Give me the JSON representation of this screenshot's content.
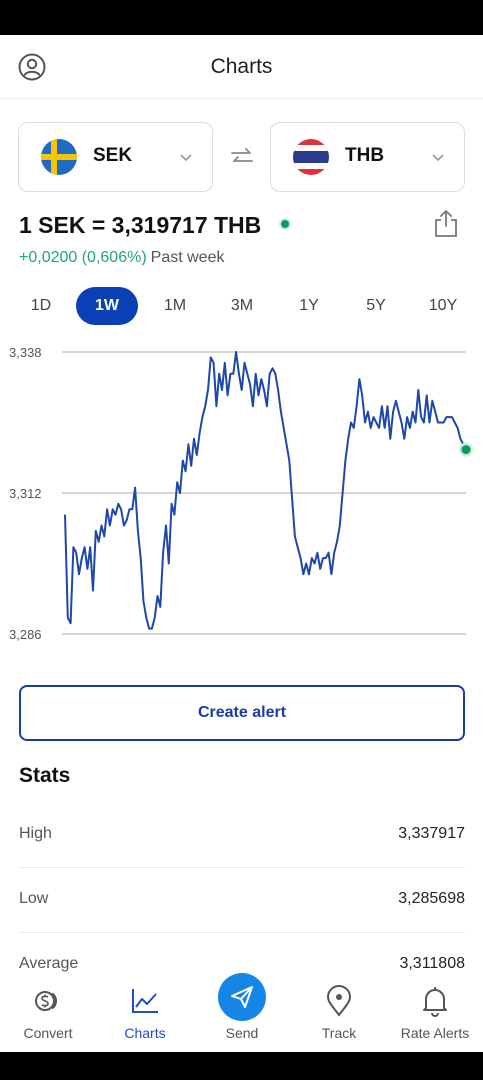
{
  "header": {
    "title": "Charts",
    "profile_icon": "profile-icon"
  },
  "pair": {
    "from": {
      "code": "SEK",
      "flag": "sweden-flag"
    },
    "to": {
      "code": "THB",
      "flag": "thailand-flag"
    }
  },
  "rate": {
    "text": "1 SEK = 3,319717 THB",
    "change": "+0,0200 (0,606%)",
    "period": "Past week"
  },
  "ranges": [
    {
      "label": "1D",
      "active": false
    },
    {
      "label": "1W",
      "active": true
    },
    {
      "label": "1M",
      "active": false
    },
    {
      "label": "3M",
      "active": false
    },
    {
      "label": "1Y",
      "active": false
    },
    {
      "label": "5Y",
      "active": false
    },
    {
      "label": "10Y",
      "active": false
    }
  ],
  "chart_data": {
    "type": "line",
    "ytick_labels": [
      "3,338",
      "3,312",
      "3,286"
    ],
    "yticks": [
      3.338,
      3.312,
      3.286
    ],
    "ylim": [
      3.286,
      3.338
    ],
    "grid": true,
    "series": [
      {
        "color": "#1f47a8",
        "values": [
          3.308,
          3.289,
          3.288,
          3.302,
          3.301,
          3.297,
          3.3,
          3.302,
          3.298,
          3.302,
          3.294,
          3.305,
          3.303,
          3.306,
          3.304,
          3.309,
          3.306,
          3.309,
          3.308,
          3.31,
          3.309,
          3.306,
          3.307,
          3.309,
          3.309,
          3.313,
          3.305,
          3.3,
          3.292,
          3.289,
          3.287,
          3.287,
          3.289,
          3.293,
          3.291,
          3.301,
          3.306,
          3.299,
          3.31,
          3.308,
          3.314,
          3.312,
          3.318,
          3.316,
          3.321,
          3.317,
          3.322,
          3.319,
          3.323,
          3.326,
          3.328,
          3.331,
          3.337,
          3.336,
          3.328,
          3.334,
          3.331,
          3.336,
          3.33,
          3.334,
          3.334,
          3.338,
          3.334,
          3.331,
          3.336,
          3.334,
          3.332,
          3.328,
          3.334,
          3.33,
          3.333,
          3.331,
          3.328,
          3.334,
          3.335,
          3.334,
          3.331,
          3.327,
          3.324,
          3.321,
          3.318,
          3.311,
          3.304,
          3.302,
          3.3,
          3.297,
          3.299,
          3.297,
          3.3,
          3.299,
          3.301,
          3.298,
          3.3,
          3.3,
          3.301,
          3.297,
          3.301,
          3.303,
          3.306,
          3.312,
          3.318,
          3.322,
          3.325,
          3.324,
          3.328,
          3.333,
          3.33,
          3.325,
          3.327,
          3.324,
          3.326,
          3.325,
          3.324,
          3.328,
          3.324,
          3.328,
          3.322,
          3.327,
          3.329,
          3.327,
          3.325,
          3.322,
          3.326,
          3.324,
          3.327,
          3.325,
          3.331,
          3.326,
          3.325,
          3.33,
          3.325,
          3.329,
          3.327,
          3.325,
          3.325,
          3.325,
          3.326,
          3.326,
          3.326,
          3.325,
          3.324,
          3.322,
          3.321,
          3.32
        ]
      }
    ]
  },
  "create_alert": "Create alert",
  "stats": {
    "title": "Stats",
    "rows": [
      {
        "label": "High",
        "value": "3,337917"
      },
      {
        "label": "Low",
        "value": "3,285698"
      },
      {
        "label": "Average",
        "value": "3,311808"
      }
    ]
  },
  "nav": [
    {
      "label": "Convert",
      "icon": "convert-icon",
      "active": false
    },
    {
      "label": "Charts",
      "icon": "charts-icon",
      "active": true
    },
    {
      "label": "Send",
      "icon": "send-icon",
      "active": false
    },
    {
      "label": "Track",
      "icon": "track-icon",
      "active": false
    },
    {
      "label": "Rate Alerts",
      "icon": "rate-alerts-icon",
      "active": false
    }
  ],
  "colors": {
    "accent": "#0b3fb5",
    "positive": "#1aab6a",
    "send": "#1585e6",
    "line": "#1f47a8"
  }
}
